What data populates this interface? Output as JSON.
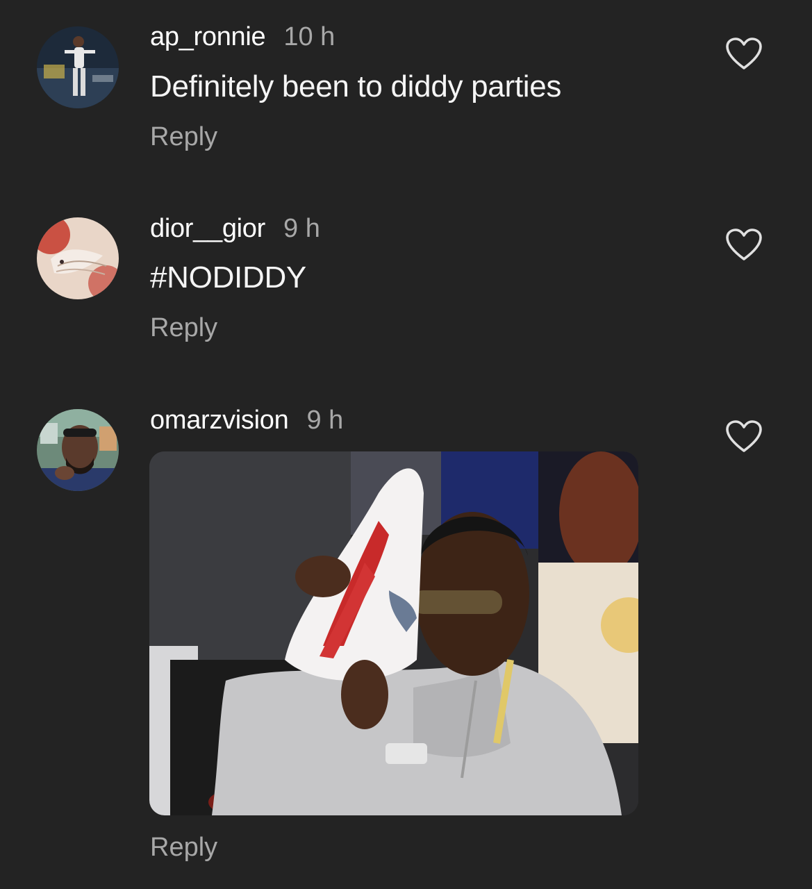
{
  "comments": [
    {
      "username": "ap_ronnie",
      "time": "10 h",
      "text": "Definitely been to diddy parties",
      "reply_label": "Reply",
      "like_icon": "heart-outline-icon"
    },
    {
      "username": "dior__gior",
      "time": "9 h",
      "text": "#NODIDDY",
      "reply_label": "Reply",
      "like_icon": "heart-outline-icon"
    },
    {
      "username": "omarzvision",
      "time": "9 h",
      "media": "gif-image",
      "reply_label": "Reply",
      "like_icon": "heart-outline-icon"
    }
  ],
  "colors": {
    "background": "#232323",
    "primary_text": "#ffffff",
    "secondary_text": "#a8a8a8",
    "icon": "#e0e0e0"
  }
}
